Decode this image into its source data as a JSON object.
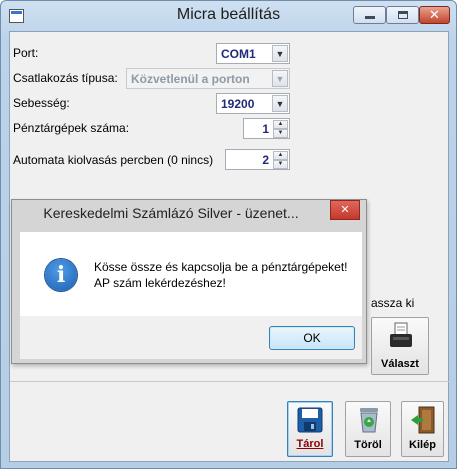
{
  "window": {
    "title": "Micra beállítás",
    "close_glyph": "✕"
  },
  "form": {
    "port_label": "Port:",
    "port_value": "COM1",
    "connection_type_label": "Csatlakozás típusa:",
    "connection_type_value": "Közvetlenül a porton",
    "speed_label": "Sebesség:",
    "speed_value": "19200",
    "registers_label": "Pénztárgépek száma:",
    "registers_value": "1",
    "auto_read_label": "Automata kiolvasás percben (0 nincs)",
    "auto_read_value": "2",
    "partial_label": "assza ki",
    "select_button_label": "Választ"
  },
  "toolbar": {
    "save_label": "Tárol",
    "delete_label": "Töröl",
    "exit_label": "Kilép"
  },
  "dialog": {
    "title": "Kereskedelmi Számlázó Silver - üzenet...",
    "close_glyph": "✕",
    "icon_glyph": "i",
    "message_line1": "Kösse össze és kapcsolja be a pénztárgépeket!",
    "message_line2": "AP szám lekérdezéshez!",
    "ok_label": "OK"
  },
  "icons": {
    "app": "app-window-icon",
    "save": "floppy-disk-icon",
    "delete": "recycle-bin-icon",
    "exit": "exit-door-icon",
    "select": "receipt-printer-icon",
    "info": "info-icon"
  },
  "colors": {
    "field_text": "#1f2a7a",
    "dialog_close": "#c4382c",
    "info_blue": "#1c5fb0"
  }
}
